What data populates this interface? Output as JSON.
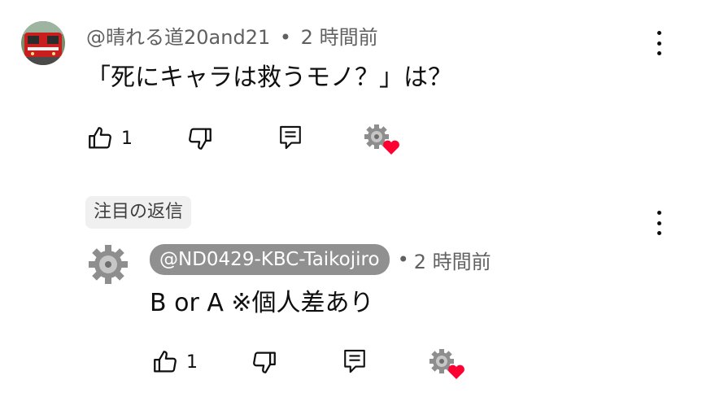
{
  "comment": {
    "author": "@晴れる道20and21",
    "separator": "•",
    "time": "2 時間前",
    "text": "「死にキャラは救うモノ？」は？",
    "like_count": "1",
    "avatar_icon": "train-avatar-icon",
    "creator_heart_icon": "gear-heart-icon"
  },
  "pinned_label": "注目の返信",
  "reply": {
    "author": "@ND0429-KBC-Taikojiro",
    "separator": "•",
    "time": "2 時間前",
    "text": "B or A ※個人差あり",
    "like_count": "1",
    "avatar_icon": "gear-avatar-icon",
    "creator_heart_icon": "gear-heart-icon"
  },
  "colors": {
    "text": "#0f0f0f",
    "meta": "#606060",
    "heart": "#ff0033",
    "pill": "#909090",
    "chip_bg": "#f0f0f0"
  }
}
